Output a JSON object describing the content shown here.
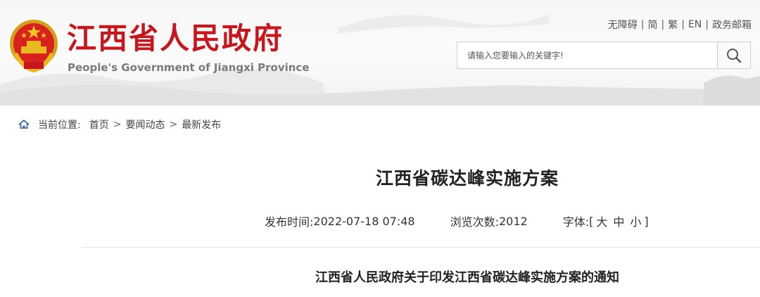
{
  "header": {
    "site_title": "江西省人民政府",
    "site_subtitle": "People's Government of Jiangxi Province",
    "emblem_icon": "national-emblem-icon",
    "brand_color": "#c8161d"
  },
  "toplinks": {
    "accessibility": "无障碍",
    "simplified": "简",
    "traditional": "繁",
    "english": "EN",
    "gov_mail": "政务邮箱",
    "separator": "|"
  },
  "search": {
    "placeholder": "请输入您要输入的关键字!",
    "button_icon": "search-icon"
  },
  "breadcrumb": {
    "label": "当前位置:",
    "items": [
      "首页",
      "要闻动态",
      "最新发布"
    ],
    "arrow": ">"
  },
  "article": {
    "title": "江西省碳达峰实施方案",
    "publish_label": "发布时间:",
    "publish_time": "2022-07-18 07:48",
    "views_label": "浏览次数:",
    "views": "2012",
    "font_label": "字体:",
    "font_open": "[",
    "font_large": "大",
    "font_medium": "中",
    "font_small": "小",
    "font_close": "]",
    "notice_title": "江西省人民政府关于印发江西省碳达峰实施方案的通知"
  }
}
